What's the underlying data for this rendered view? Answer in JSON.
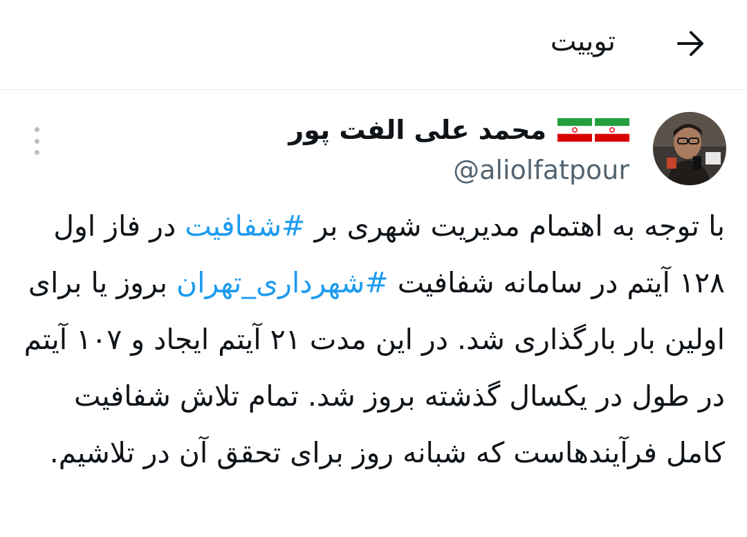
{
  "header": {
    "title": "توییت",
    "back_icon": "arrow-right-icon"
  },
  "author": {
    "display_name": "محمد علی الفت پور",
    "handle": "@aliolfatpour",
    "flags": [
      "iran-flag-icon",
      "iran-flag-icon"
    ]
  },
  "tweet": {
    "segments": [
      "با توجه به اهتمام مدیریت شهری بر ",
      "#شفافیت",
      " در فاز اول ۱۲۸ آیتم در سامانه شفافیت ",
      "#شهرداری_تهران",
      " بروز یا برای اولین بار بارگذاری شد. در این مدت ۲۱ آیتم ایجاد و ۱۰۷ آیتم در طول در یکسال گذشته بروز شد. تمام تلاش شفافیت کامل فرآیندهاست که شبانه روز برای تحقق آن در تلاشیم."
    ]
  },
  "colors": {
    "link": "#1d9bf0",
    "secondary_text": "#536471",
    "divider": "#e6e8ea"
  }
}
